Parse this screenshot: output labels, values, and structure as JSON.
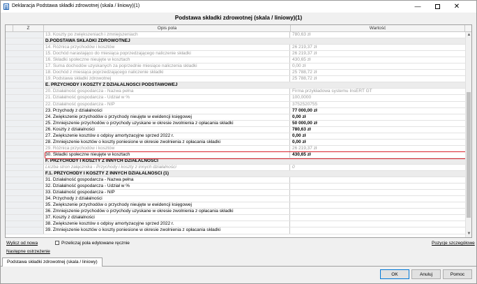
{
  "window": {
    "title": "Deklaracja Podstawa składki zdrowotnej (skala / liniowy)(1)",
    "minimize": "—",
    "close": "✕"
  },
  "heading": "Podstawa składki zdrowotnej (skala / liniowy)(1)",
  "grid": {
    "columns": {
      "z": "Z",
      "desc": "Opis pola",
      "value": "Wartość"
    },
    "rows": [
      {
        "type": "dis",
        "desc": "13. Koszty po zwiększeniach i zmniejszeniach",
        "value": "780,63 zł"
      },
      {
        "type": "section",
        "desc": "D.PODSTAWA SKŁADKI ZDROWOTNEJ",
        "value": ""
      },
      {
        "type": "dis",
        "desc": "14. Różnica przychodów i kosztów",
        "value": "26 219,37 zł"
      },
      {
        "type": "dis",
        "desc": "15. Dochód narastająco do miesiąca poprzedzającego naliczenie składki",
        "value": "26 219,37 zł"
      },
      {
        "type": "dis",
        "desc": "16. Składki społeczne nieujęte w kosztach",
        "value": "430,65 zł"
      },
      {
        "type": "dis",
        "desc": "17. Suma dochodów uzyskanych za poprzednie miesiące naliczenia składki",
        "value": "0,00 zł"
      },
      {
        "type": "dis",
        "desc": "18. Dochód z miesiąca poprzedzającego naliczenie składki",
        "value": "25 788,72 zł"
      },
      {
        "type": "dis",
        "desc": "19. Podstawa składki zdrowotnej",
        "value": "25 788,72 zł"
      },
      {
        "type": "section",
        "desc": "E. PRZYCHODY I KOSZTY Z DZIAŁALNOŚCI PODSTAWOWEJ",
        "value": ""
      },
      {
        "type": "dis",
        "desc": "20. Działalność gospodarcza - Nazwa pełna",
        "value": "Firma przykładowa systemu InsERT GT"
      },
      {
        "type": "dis",
        "desc": "21. Działalność gospodarcza - Udział w %",
        "value": "100,0000"
      },
      {
        "type": "dis",
        "desc": "22. Działalność gospodarcza - NIP",
        "value": "3752520755"
      },
      {
        "type": "strong",
        "desc": "23. Przychody z działalności",
        "value": "77 000,00 zł"
      },
      {
        "type": "strong",
        "desc": "24. Zwiększenie przychodów o przychody nieujęte w ewidencji księgowej",
        "value": "0,00 zł"
      },
      {
        "type": "strong",
        "desc": "25. Zmniejszenie przychodów o przychody uzyskane w okresie zwolnienia z opłacania składki",
        "value": "50 000,00 zł"
      },
      {
        "type": "strong",
        "desc": "26. Koszty z działalności",
        "value": "780,63 zł"
      },
      {
        "type": "strong",
        "desc": "27. Zwiększenie kosztów o odpisy amortyzacyjne sprzed 2022 r.",
        "value": "0,00 zł"
      },
      {
        "type": "strong",
        "desc": "28. Zmniejszenie kosztów o koszty poniesione w okresie zwolnienia z opłacania składki",
        "value": "0,00 zł"
      },
      {
        "type": "dis",
        "desc": "29. Różnica przychodów i kosztów",
        "value": "26 219,37 zł"
      },
      {
        "type": "strong",
        "desc": "30. Składki społeczne nieujęte w kosztach",
        "value": "430,65 zł"
      },
      {
        "type": "section",
        "desc": "F. PRZYCHODY I KOSZTY Z INNYCH DZIAŁALNOŚCI",
        "value": ""
      },
      {
        "type": "ital",
        "desc": "Liczba stron załącznika - Przychody i koszty z innych działalności",
        "value": "0"
      },
      {
        "type": "section",
        "desc": "F.1. PRZYCHODY I KOSZTY Z INNYCH DZIAŁALNOŚCI (1)",
        "value": ""
      },
      {
        "type": "normal",
        "desc": "31. Działalność gospodarcza - Nazwa pełna",
        "value": ""
      },
      {
        "type": "normal",
        "desc": "32. Działalność gospodarcza - Udział w %",
        "value": ""
      },
      {
        "type": "normal",
        "desc": "33. Działalność gospodarcza - NIP",
        "value": ""
      },
      {
        "type": "normal",
        "desc": "34. Przychody z działalności",
        "value": ""
      },
      {
        "type": "normal",
        "desc": "35. Zwiększenie przychodów o przychody nieujęte w ewidencji księgowej",
        "value": ""
      },
      {
        "type": "normal",
        "desc": "36. Zmniejszenie przychodów o przychody uzyskane w okresie zwolnienia z opłacania składki",
        "value": ""
      },
      {
        "type": "normal",
        "desc": "37. Koszty z działalności",
        "value": ""
      },
      {
        "type": "normal",
        "desc": "38. Zwiększenie kosztów o odpisy amortyzacyjne sprzed 2022 r.",
        "value": ""
      },
      {
        "type": "normal",
        "desc": "39. Zmniejszenie kosztów o koszty poniesione w okresie zwolnienia z opłacania składki",
        "value": ""
      }
    ]
  },
  "footer": {
    "recalc": "Wylicz od nowa",
    "override_checkbox": "Przeliczaj pola edytowane ręcznie",
    "next_warning": "Następne ostrzeżenie",
    "details": "Pozycje szczegółowe"
  },
  "tab": "Podstawa składki zdrowotnej (skala / liniowy)",
  "buttons": {
    "ok": "OK",
    "cancel": "Anuluj",
    "help": "Pomoc"
  }
}
